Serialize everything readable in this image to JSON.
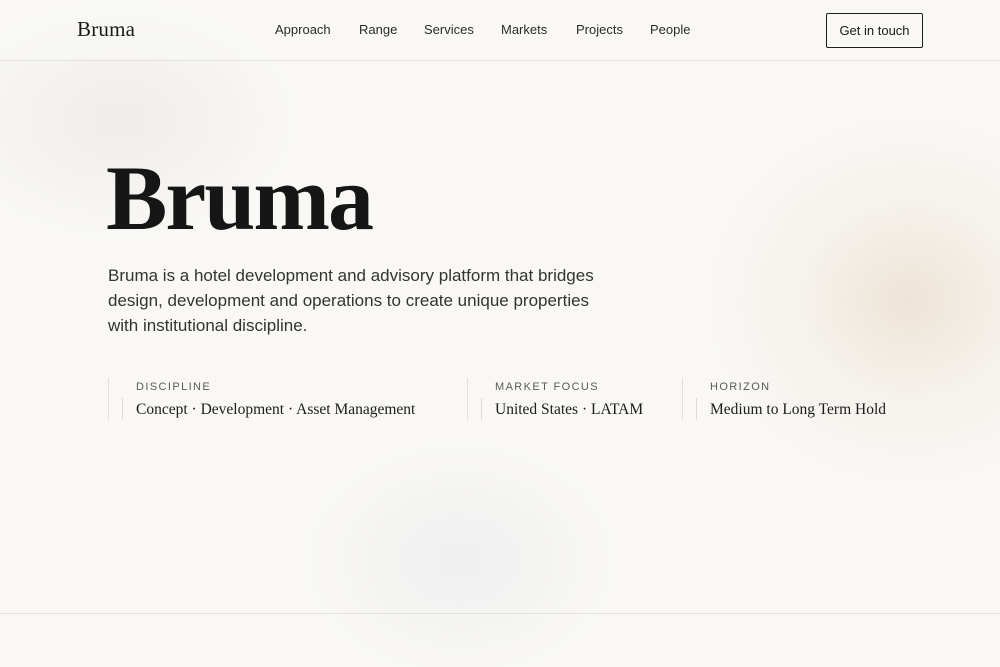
{
  "brand": {
    "name": "Bruma"
  },
  "nav": {
    "items": [
      {
        "label": "Approach"
      },
      {
        "label": "Range"
      },
      {
        "label": "Services"
      },
      {
        "label": "Markets"
      },
      {
        "label": "Projects"
      },
      {
        "label": "People"
      }
    ],
    "cta_label": "Get in touch"
  },
  "hero": {
    "title": "Bruma",
    "description": "Bruma is a hotel development and advisory platform that bridges design, development and operations to create unique properties with institutional discipline."
  },
  "facts": [
    {
      "label": "DISCIPLINE",
      "value": "Concept · Development · Asset Management"
    },
    {
      "label": "MARKET FOCUS",
      "value": "United States · LATAM"
    },
    {
      "label": "HORIZON",
      "value": "Medium to Long Term Hold"
    }
  ],
  "colors": {
    "background": "#f9f8f5",
    "text": "#1a1a1a",
    "accent_glow": "#ece1d2"
  }
}
